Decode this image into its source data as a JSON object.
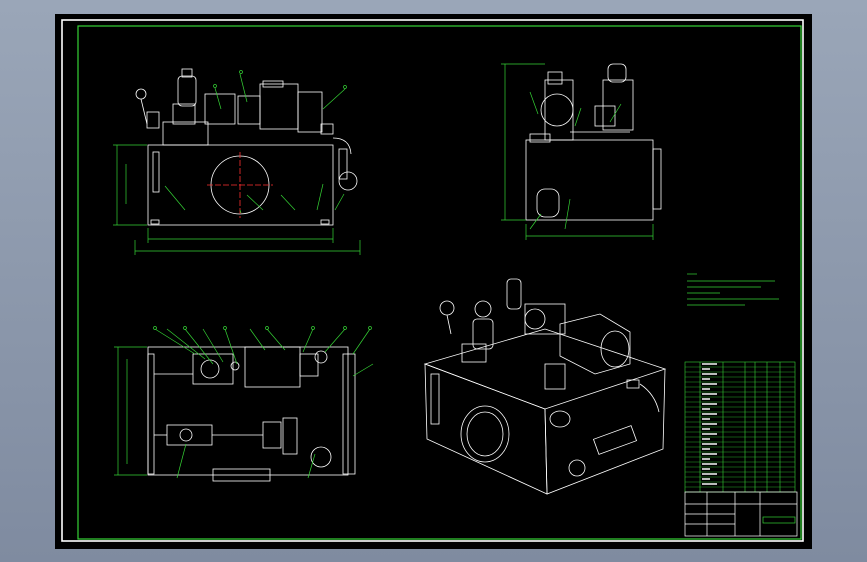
{
  "drawing": {
    "background_color": "#000000",
    "frame_color": "#ffffff",
    "line_color": "#ffffff",
    "dimension_color": "#35d335",
    "leader_color": "#35d335",
    "center_line_color": "#ff3030",
    "ui_background": "#8f9bb0"
  }
}
